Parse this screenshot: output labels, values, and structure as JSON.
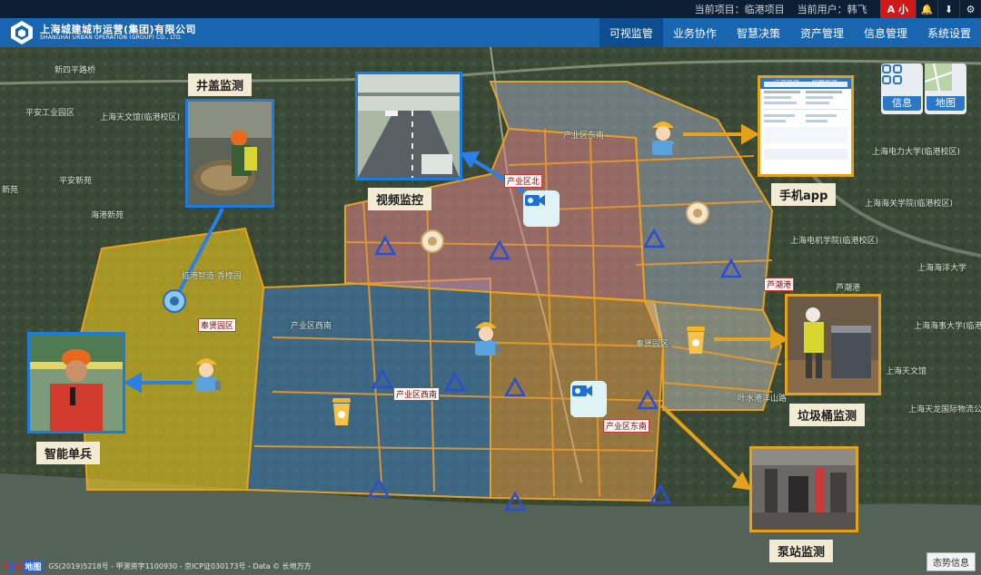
{
  "topbar": {
    "project_label": "当前项目：临港项目",
    "user_label": "当前用户：韩飞",
    "lang_button": "A 小"
  },
  "brand": {
    "name_cn": "上海城建城市运营(集团)有限公司",
    "name_en": "SHANGHAI URBAN OPERATION (GROUP) CO., LTD."
  },
  "nav": {
    "items": [
      "可视监管",
      "业务协作",
      "智慧决策",
      "资产管理",
      "信息管理",
      "系统设置"
    ],
    "active_index": 0
  },
  "map": {
    "place_labels": [
      "新四平路桥",
      "平安工业园区",
      "平安新苑",
      "海港新苑",
      "新苑",
      "上海电力大学(临港校区)",
      "上海电机学院(临港校区)",
      "上海海洋大学",
      "上海海事大学(临港校区)",
      "上海海关学院(临港校区)",
      "上海天文馆",
      "上海天文馆(临港校区)",
      "上海天龙国际物流公司",
      "叶水港洋山路",
      "产业区东南",
      "临港智造·香樟园",
      "奉贤园区",
      "产业区西南",
      "芦潮港"
    ],
    "boxed_labels": [
      "奉贤园区",
      "产业区西南",
      "产业区东南",
      "芦潮港",
      "产业区北"
    ],
    "copyright": "GS(2019)5218号 - 甲测资字1100930 - 京ICP证030173号 - Data © 长地万方",
    "baidu_brand": "Bai",
    "baidu_cn": "地图"
  },
  "callouts": {
    "manhole": "井盖监测",
    "video": "视频监控",
    "app": "手机app",
    "bin": "垃圾桶监测",
    "pump": "泵站监测",
    "soldier": "智能单兵"
  },
  "phone_screen": {
    "title": "运营管理——报警管理"
  },
  "tiles": {
    "info": "信息",
    "map": "地图"
  },
  "situation_button": "态势信息"
}
